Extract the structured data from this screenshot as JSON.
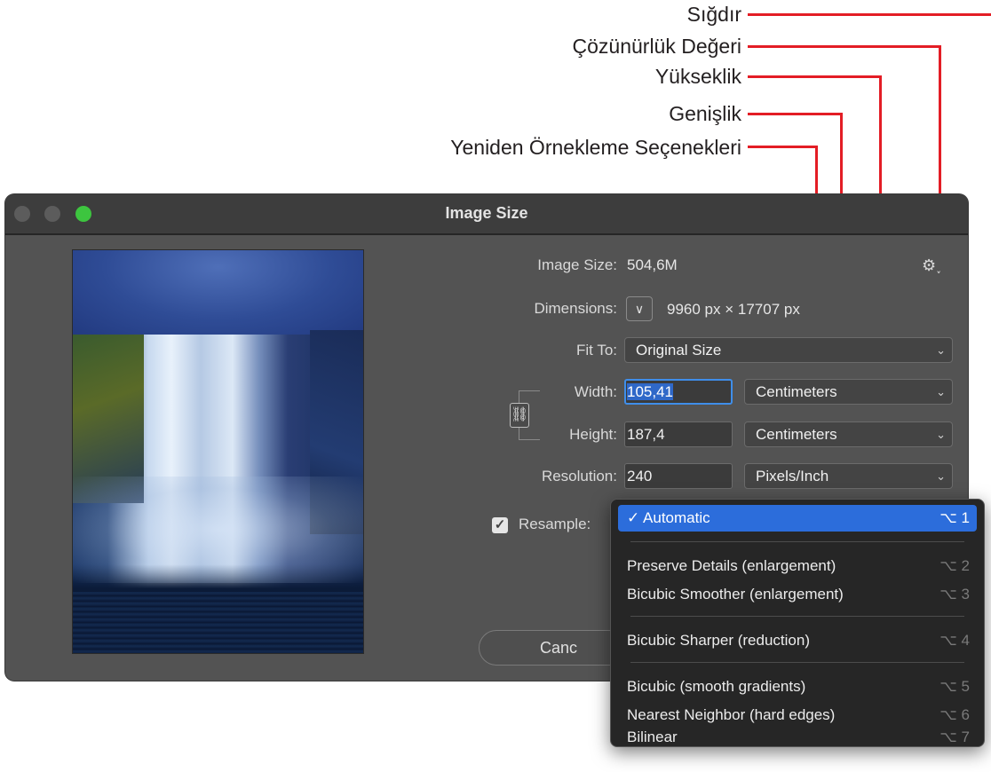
{
  "annotations": {
    "fit": "Sığdır",
    "resolution_value": "Çözünürlük Değeri",
    "height": "Yükseklik",
    "width": "Genişlik",
    "resample_options": "Yeniden Örnekleme Seçenekleri",
    "arrow_color": "#e31d25"
  },
  "window": {
    "title": "Image Size",
    "traffic_lights": [
      "close",
      "minimize",
      "zoom"
    ],
    "zoom_color": "#3dc53f"
  },
  "form": {
    "image_size_label": "Image Size:",
    "image_size_value": "504,6M",
    "settings_icon": "gear-icon",
    "dimensions_label": "Dimensions:",
    "dimensions_toggle": "∨",
    "dimensions_value": "9960 px  ×  17707 px",
    "fit_to_label": "Fit To:",
    "fit_to_value": "Original Size",
    "width_label": "Width:",
    "width_value": "105,41",
    "width_unit": "Centimeters",
    "height_label": "Height:",
    "height_value": "187,4",
    "height_unit": "Centimeters",
    "resolution_label": "Resolution:",
    "resolution_value": "240",
    "resolution_unit": "Pixels/Inch",
    "constrain_icon": "link-icon",
    "resample_label": "Resample:",
    "resample_checked": true,
    "cancel_label": "Canc"
  },
  "resample_menu": {
    "selected": "Automatic",
    "items": [
      {
        "label": "✓ Automatic",
        "shortcut": "⌥ 1"
      },
      {
        "label": "Preserve Details (enlargement)",
        "shortcut": "⌥ 2"
      },
      {
        "label": "Bicubic Smoother (enlargement)",
        "shortcut": "⌥ 3"
      },
      {
        "label": "Bicubic Sharper (reduction)",
        "shortcut": "⌥ 4"
      },
      {
        "label": "Bicubic (smooth gradients)",
        "shortcut": "⌥ 5"
      },
      {
        "label": "Nearest Neighbor (hard edges)",
        "shortcut": "⌥ 6"
      },
      {
        "label": "Bilinear",
        "shortcut": "⌥ 7"
      }
    ]
  }
}
